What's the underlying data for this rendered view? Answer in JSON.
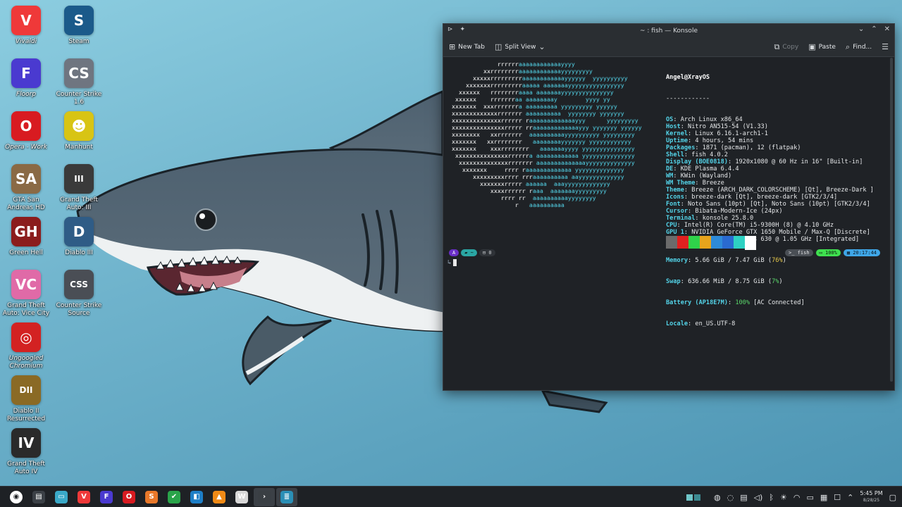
{
  "desktop": {
    "icons": [
      {
        "label": "Vivaldi",
        "italic": true,
        "glyph": "V",
        "color": "#ef3939"
      },
      {
        "label": "Steam",
        "italic": false,
        "glyph": "S",
        "color": "#1b5a8a"
      },
      {
        "label": "Floorp",
        "italic": true,
        "glyph": "F",
        "color": "#4a3ad0"
      },
      {
        "label": "Counter Strike 1.6",
        "italic": false,
        "glyph": "CS",
        "color": "#6f7580"
      },
      {
        "label": "Opera - Work",
        "italic": true,
        "glyph": "O",
        "color": "#d81b21"
      },
      {
        "label": "Manhunt",
        "italic": false,
        "glyph": "☻",
        "color": "#d8c414"
      },
      {
        "label": "GTA San Andreas HD",
        "italic": false,
        "glyph": "SA",
        "color": "#8a6a45"
      },
      {
        "label": "Grand Theft Auto: III",
        "italic": false,
        "glyph": "III",
        "color": "#3a3a3a"
      },
      {
        "label": "Green Hell",
        "italic": false,
        "glyph": "GH",
        "color": "#8b1c1c"
      },
      {
        "label": "Diablo III",
        "italic": false,
        "glyph": "D",
        "color": "#2f5c86"
      },
      {
        "label": "Grand Theft Auto: Vice City",
        "italic": false,
        "glyph": "VC",
        "color": "#e06aa7"
      },
      {
        "label": "Counter Strike Source",
        "italic": false,
        "glyph": "CSS",
        "color": "#4a4e55"
      },
      {
        "label": "Ungoogled Chromium",
        "italic": true,
        "glyph": "◎",
        "color": "#d32222"
      },
      {
        "label": "Diablo II Resurrected",
        "italic": false,
        "glyph": "DII",
        "color": "#8a6a25"
      },
      {
        "label": "Grand Theft Auto IV",
        "italic": false,
        "glyph": "IV",
        "color": "#2a2a2a"
      }
    ]
  },
  "konsole": {
    "title": "~ : fish — Konsole",
    "toolbar": {
      "new_tab": "New Tab",
      "split_view": "Split View",
      "copy": "Copy",
      "paste": "Paste",
      "find": "Find..."
    },
    "logo_lines": [
      "               rrrrrraaaaaaaaaaaayyyy",
      "           xxrrrrrrrraaaaaaaaaaaayyyyyyyyy",
      "        xxxxxrrrrrrrrraaaaaaaaaaaayyyyyy  yyyyyyyyyy",
      "      xxxxxxxrrrrrrrrraaaaa aaaaaaayyyyyyyyyyyyyyyy",
      "    xxxxxx   rrrrrrrraaaa aaaaaaayyyyyyyyyyyyyyy",
      "   xxxxxx    rrrrrrraa aaaaaaaay        yyyy yy",
      "  xxxxxxx  xxxrrrrrrra aaaaaaaaa yyyyyyyyy yyyyyy",
      "  xxxxxxxxxxxxxrrrrrrr aaaaaaaaaa  yyyyyyyy yyyyyyy",
      "  xxxxxxxxxxxxxxrrrrrr raaaaaaaaaaaaayyy      yyyyyyyyy",
      "  xxxxxxxxxxxxxxxrrrrr rraaaaaaaaaaaaayyy yyyyyyy yyyyyy",
      "  xxxxxxxx   xxrrrrrrr  aaaaaaaaaayyyyyyyyyy yyyyyyyyy",
      "  xxxxxxx   xxrrrrrrrr   aaaaaaaayyyyyyy yyyyyyyyyyyy",
      "  xxxxxxx    xxxrrrrrrrr   aaaaaaayyyy yyyyyyyyyyyyyyy",
      "   xxxxxxxxxxxxxxxrrrrrra aaaaaaaaaaaa yyyyyyyyyyyyyyy",
      "    xxxxxxxxxxxxxxrrrrrrr aaaaaaaaaaaaaayyyyyyyyyyyyyy",
      "     xxxxxxx     rrrr raaaaaaaaaaaaa yyyyyyyyyyyyyy",
      "        xxxxxxxxxrrrr rrraaaaaaaaaa aayyyyyyyyyyyyy",
      "          xxxxxxxrrrrr aaaaaa  aaayyyyyyyyyyyyy",
      "             xxxxrrrrrr raaa  aaaaaaayyyyyyyyy",
      "                rrrr rr  aaaaaaaaaayyyyyyyy",
      "                    r   aaaaaaaaaa"
    ],
    "info": {
      "user_host": "Angel@XrayOS",
      "separator": "------------",
      "rows": [
        {
          "key": "OS",
          "value": "Arch Linux x86_64"
        },
        {
          "key": "Host",
          "value": "Nitro AN515-54 (V1.33)"
        },
        {
          "key": "Kernel",
          "value": "Linux 6.16.1-arch1-1"
        },
        {
          "key": "Uptime",
          "value": "4 hours, 54 mins"
        },
        {
          "key": "Packages",
          "value": "1871 (pacman), 12 (flatpak)"
        },
        {
          "key": "Shell",
          "value": "fish 4.0.2"
        },
        {
          "key": "Display (BOE0818)",
          "value": "1920x1080 @ 60 Hz in 16\" [Built-in]"
        },
        {
          "key": "DE",
          "value": "KDE Plasma 6.4.4"
        },
        {
          "key": "WM",
          "value": "KWin (Wayland)"
        },
        {
          "key": "WM Theme",
          "value": "Breeze"
        },
        {
          "key": "Theme",
          "value": "Breeze (ARCH_DARK_COLORSCHEME) [Qt], Breeze-Dark ]"
        },
        {
          "key": "Icons",
          "value": "breeze-dark [Qt], breeze-dark [GTK2/3/4]"
        },
        {
          "key": "Font",
          "value": "Noto Sans (10pt) [Qt], Noto Sans (10pt) [GTK2/3/4]"
        },
        {
          "key": "Cursor",
          "value": "Bibata-Modern-Ice (24px)"
        },
        {
          "key": "Terminal",
          "value": "konsole 25.8.0"
        },
        {
          "key": "CPU",
          "value": "Intel(R) Core(TM) i5-9300H (8) @ 4.10 GHz"
        },
        {
          "key": "GPU 1",
          "value": "NVIDIA GeForce GTX 1650 Mobile / Max-Q [Discrete]"
        },
        {
          "key": "GPU 2",
          "value": "Intel UHD Graphics 630 @ 1.05 GHz [Integrated]"
        }
      ],
      "memory_key": "Memory",
      "memory_value": "5.66 GiB / 7.47 GiB (",
      "memory_pct": "76%",
      "memory_close": ")",
      "swap_key": "Swap",
      "swap_value": "636.66 MiB / 8.75 GiB (",
      "swap_pct": "7%",
      "swap_close": ")",
      "battery_key": "Battery (AP18E7M)",
      "battery_pct": "100%",
      "battery_value": " [AC Connected]",
      "locale_key": "Locale",
      "locale_value": "en_US.UTF-8"
    },
    "palette": [
      "#6b6b6b",
      "#e02020",
      "#2fd24a",
      "#e7a41c",
      "#2e8ad8",
      "#2a6ad0",
      "#2ed1c2",
      "#ffffff"
    ],
    "prompt": {
      "arch_glyph": "A",
      "dir_glyph": "~",
      "jobs": "0",
      "shell": "fish",
      "battery": "100%",
      "time": "20:17:44",
      "arrow": "↳",
      "colors": {
        "purple": "#6a2fc7",
        "teal": "#2aa6a3",
        "green": "#3fe04f",
        "blue": "#3fa7e8"
      }
    }
  },
  "taskbar": {
    "apps": [
      {
        "name": "launcher",
        "glyph": "◉",
        "color": "#ffffff"
      },
      {
        "name": "terminal-pinned",
        "glyph": "▤",
        "color": "#3b4046"
      },
      {
        "name": "files",
        "glyph": "▭",
        "color": "#3aa9c8"
      },
      {
        "name": "vivaldi",
        "glyph": "V",
        "color": "#ef3939"
      },
      {
        "name": "floorp",
        "glyph": "F",
        "color": "#4a3ad0"
      },
      {
        "name": "opera",
        "glyph": "O",
        "color": "#d81b21"
      },
      {
        "name": "sublime",
        "glyph": "S",
        "color": "#e8782a"
      },
      {
        "name": "vscode-alt",
        "glyph": "✔",
        "color": "#2aa44a"
      },
      {
        "name": "dolphin",
        "glyph": "◧",
        "color": "#1e7fc7"
      },
      {
        "name": "vlc",
        "glyph": "▲",
        "color": "#f08a16"
      },
      {
        "name": "wps",
        "glyph": "W",
        "color": "#d8d8d8"
      },
      {
        "name": "konsole",
        "glyph": "›",
        "color": "#3a3f44"
      },
      {
        "name": "kate",
        "glyph": "≣",
        "color": "#2b8fb6"
      }
    ],
    "clock_time": "5:45 PM",
    "clock_date": "8/28/25"
  }
}
